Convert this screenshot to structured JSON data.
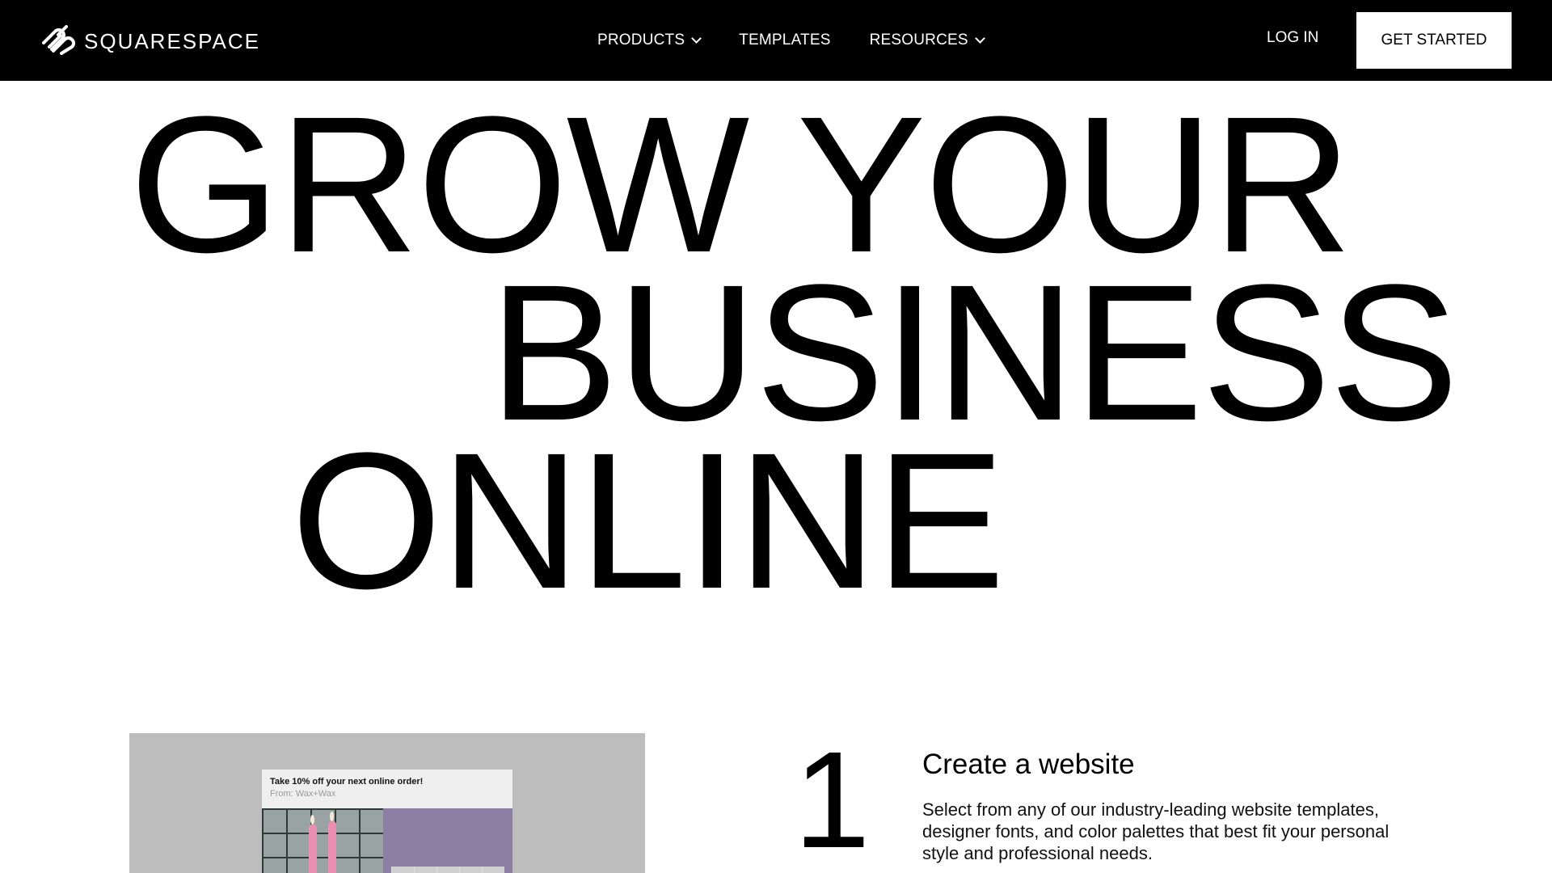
{
  "nav": {
    "brand": "SQUARESPACE",
    "links": [
      {
        "label": "PRODUCTS",
        "has_dropdown": true
      },
      {
        "label": "TEMPLATES",
        "has_dropdown": false
      },
      {
        "label": "RESOURCES",
        "has_dropdown": true
      }
    ],
    "login_label": "LOG IN",
    "cta_label": "GET STARTED",
    "icons": {
      "logo": "squarespace-logo-icon",
      "dropdown": "chevron-down-icon"
    }
  },
  "hero": {
    "lines": [
      "GROW YOUR",
      "BUSINESS",
      "ONLINE"
    ]
  },
  "preview": {
    "email_subject": "Take 10% off your next online order!",
    "email_from": "From: Wax+Wax"
  },
  "steps": [
    {
      "number": "1",
      "title": "Create a website",
      "description": "Select from any of our industry-leading website templates, designer fonts, and color palettes that best fit your personal style and professional needs."
    }
  ],
  "colors": {
    "nav_bg": "#000000",
    "page_bg": "#ffffff",
    "cta_bg": "#ffffff",
    "preview_bg": "#bdbdbd",
    "email_accent": "#8c7fa3"
  }
}
